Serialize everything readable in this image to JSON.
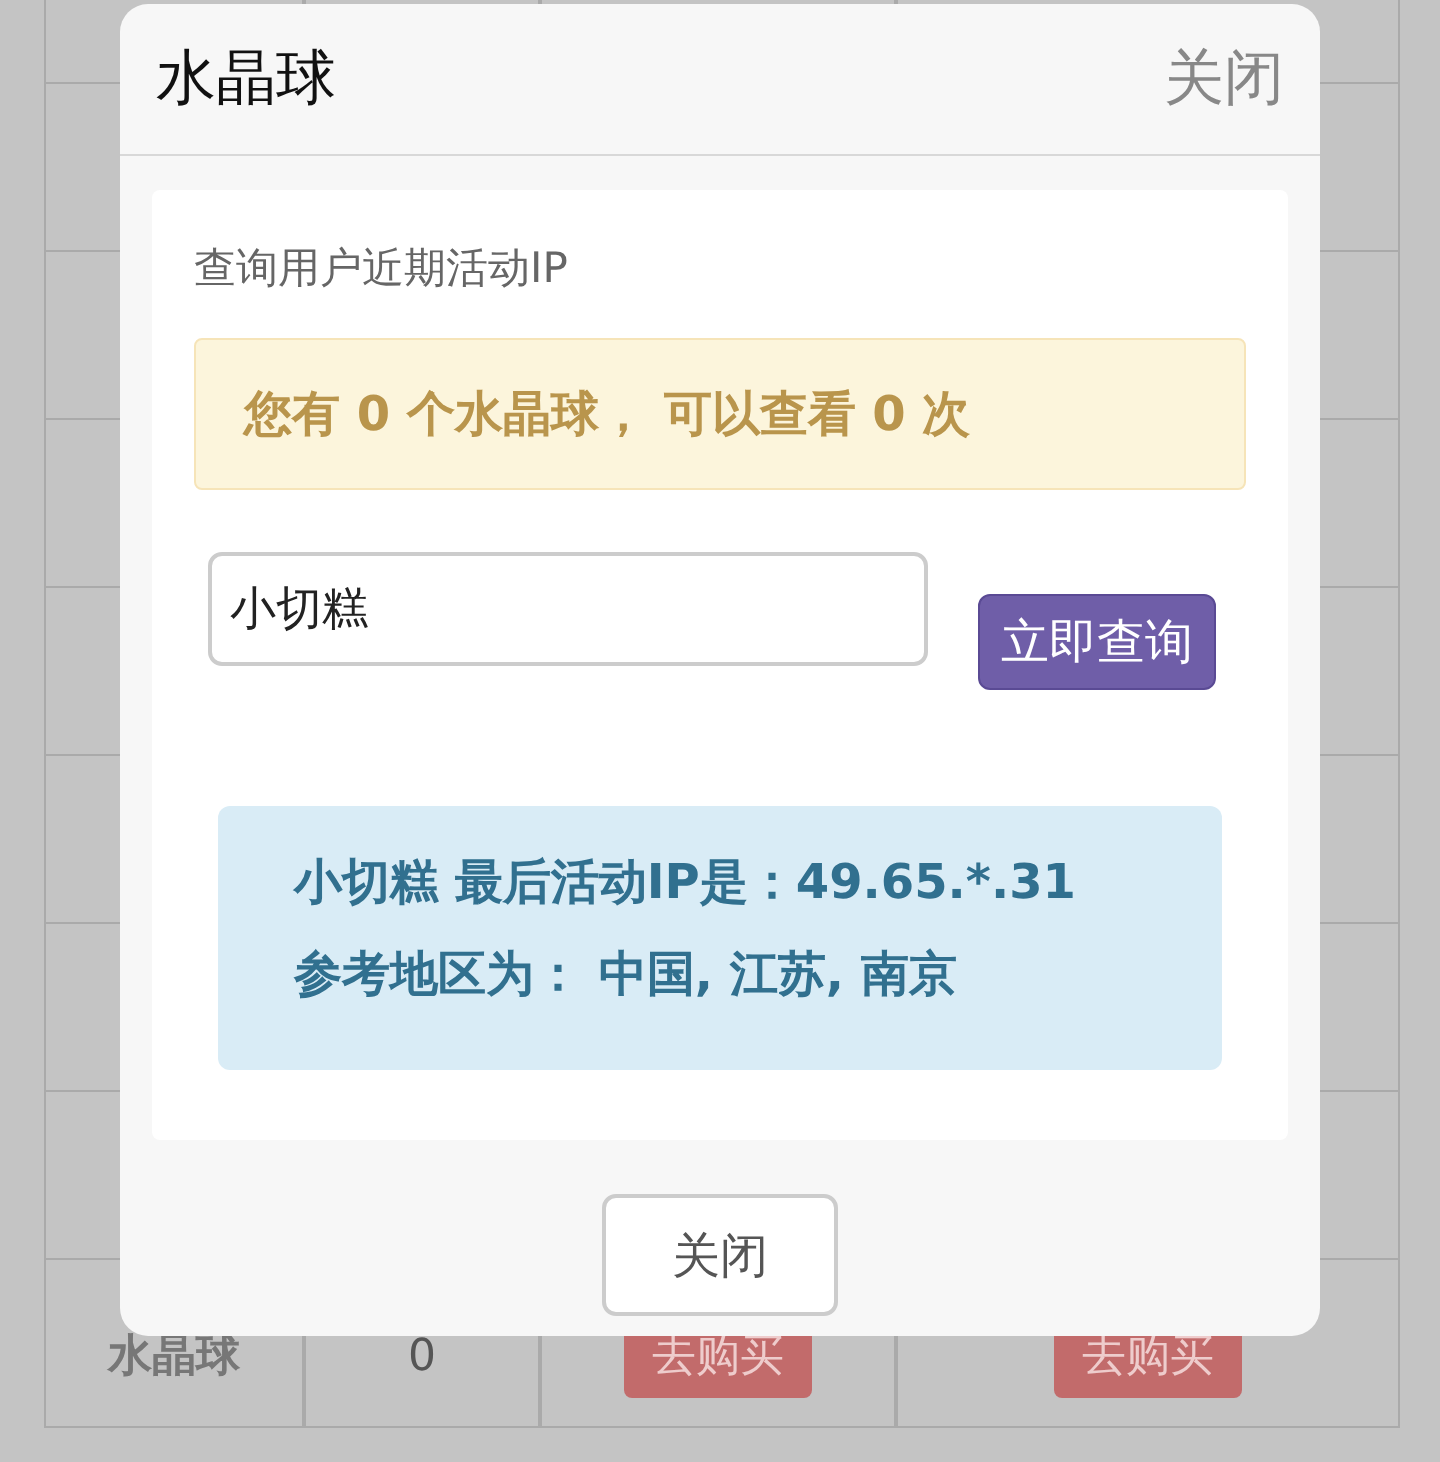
{
  "background_table": {
    "rows": [
      {
        "cells": [
          {
            "text": "水晶球",
            "kind": "label"
          },
          {
            "text": "0",
            "kind": "count"
          },
          {
            "text": "去购买",
            "kind": "buy"
          },
          {
            "text": "去购买",
            "kind": "buy"
          }
        ]
      }
    ]
  },
  "dialog": {
    "title": "水晶球",
    "header_close": "关闭",
    "subtitle": "查询用户近期活动IP",
    "notice": "您有 0 个水晶球， 可以查看 0 次",
    "search": {
      "value": "小切糕"
    },
    "query_button": "立即查询",
    "result_lines": [
      "小切糕 最后活动IP是：49.65.*.31",
      "参考地区为： 中国, 江苏, 南京"
    ],
    "footer_button": "关闭"
  }
}
